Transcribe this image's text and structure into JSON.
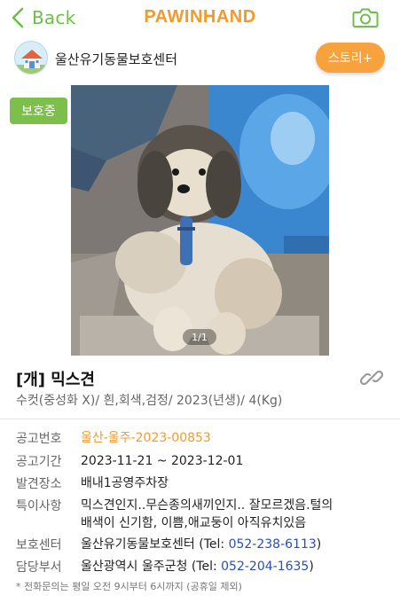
{
  "nav": {
    "back_label": "Back",
    "logo_text": "PAWINHAND"
  },
  "shelter": {
    "name": "울산유기동물보호센터",
    "story_button": "스토리+"
  },
  "photo": {
    "status_badge": "보호중",
    "page_indicator": "1/1"
  },
  "animal": {
    "title": "[개] 믹스견",
    "subtitle": "수컷(중성화 X)/ 흰,회색,검정/ 2023(년생)/ 4(Kg)"
  },
  "details": {
    "notice_no": {
      "label": "공고번호",
      "value": "울산-울주-2023-00853"
    },
    "notice_period": {
      "label": "공고기간",
      "value": "2023-11-21 ~ 2023-12-01"
    },
    "found_place": {
      "label": "발견장소",
      "value": "배내1공영주차장"
    },
    "remarks": {
      "label": "특이사항",
      "value": "믹스견인지..무슨종의새끼인지.. 잘모르겠음.털의 배색이 신기함, 이쁨,애교둥이 아직유치있음"
    },
    "shelter_center": {
      "label": "보호센터",
      "name": "울산유기동물보호센터",
      "tel_prefix": "(Tel: ",
      "tel": "052-238-6113",
      "tel_suffix": ")"
    },
    "department": {
      "label": "담당부서",
      "name": "울산광역시 울주군청",
      "tel_prefix": "(Tel: ",
      "tel": "052-204-1635",
      "tel_suffix": ")"
    }
  },
  "footnote": "* 전화문의는 평일 오전 9시부터 6시까지 (공휴일 제외)",
  "colors": {
    "accent_green": "#6cc04a",
    "brand_orange": "#f29a2e",
    "status_green": "#7cbf4b",
    "tel_blue": "#2a4fb3"
  },
  "icons": {
    "back": "chevron-left-icon",
    "camera": "camera-icon",
    "shelter_avatar": "house-icon",
    "share_link": "link-icon"
  }
}
